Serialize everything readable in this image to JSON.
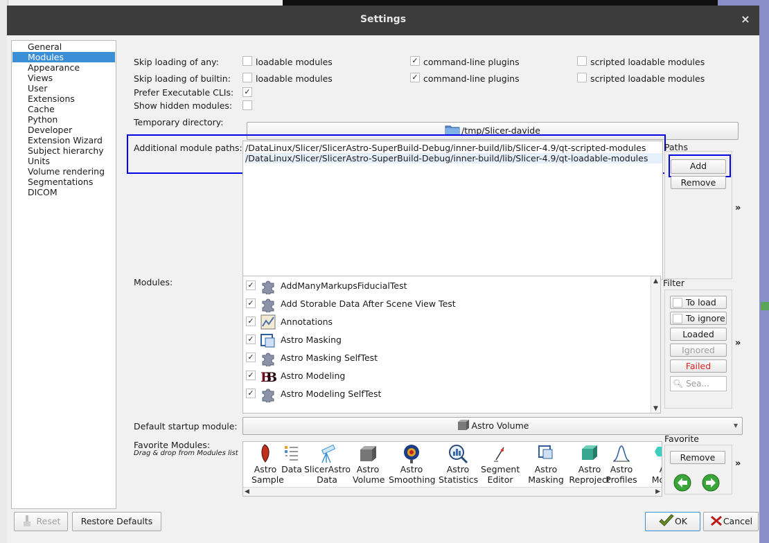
{
  "dialog": {
    "title": "Settings",
    "close_glyph": "×"
  },
  "nav": {
    "items": [
      "General",
      "Modules",
      "Appearance",
      "Views",
      "User",
      "Extensions",
      "Cache",
      "Python",
      "Developer",
      "Extension Wizard",
      "Subject hierarchy",
      "Units",
      "Volume rendering",
      "Segmentations",
      "DICOM"
    ],
    "selected": "Modules"
  },
  "skip_any": {
    "label": "Skip loading of any:",
    "loadable": {
      "label": "loadable modules",
      "checked": false
    },
    "cli": {
      "label": "command-line plugins",
      "checked": true
    },
    "scripted": {
      "label": "scripted loadable modules",
      "checked": false
    }
  },
  "skip_builtin": {
    "label": "Skip loading of builtin:",
    "loadable": {
      "label": "loadable modules",
      "checked": false
    },
    "cli": {
      "label": "command-line plugins",
      "checked": true
    },
    "scripted": {
      "label": "scripted loadable modules",
      "checked": false
    }
  },
  "prefer_cli": {
    "label": "Prefer Executable CLIs:",
    "checked": true
  },
  "show_hidden": {
    "label": "Show hidden modules:",
    "checked": false
  },
  "check_glyph": "✓",
  "temp_dir": {
    "label": "Temporary directory:",
    "value": "/tmp/Slicer-davide",
    "icon": "folder-icon"
  },
  "module_paths": {
    "label": "Additional module paths:",
    "paths": [
      "/DataLinux/Slicer/SlicerAstro-SuperBuild-Debug/inner-build/lib/Slicer-4.9/qt-scripted-modules",
      "/DataLinux/Slicer/SlicerAstro-SuperBuild-Debug/inner-build/lib/Slicer-4.9/qt-loadable-modules"
    ],
    "side_title": "Paths",
    "add_label": "Add",
    "remove_label": "Remove",
    "expand_glyph": "»"
  },
  "modules": {
    "label": "Modules:",
    "items": [
      {
        "name": "AddManyMarkupsFiducialTest",
        "checked": true,
        "icon": "puzzle-icon"
      },
      {
        "name": "Add Storable Data After Scene View Test",
        "checked": true,
        "icon": "puzzle-icon"
      },
      {
        "name": "Annotations",
        "checked": true,
        "icon": "annotations-icon"
      },
      {
        "name": "Astro Masking",
        "checked": true,
        "icon": "astro-masking-icon"
      },
      {
        "name": "Astro Masking SelfTest",
        "checked": true,
        "icon": "puzzle-icon"
      },
      {
        "name": "Astro Modeling",
        "checked": true,
        "icon": "astro-modeling-icon"
      },
      {
        "name": "Astro Modeling SelfTest",
        "checked": true,
        "icon": "puzzle-icon"
      }
    ],
    "filter_title": "Filter",
    "filters": [
      {
        "label": "To load",
        "checkbox": true
      },
      {
        "label": "To ignore",
        "checkbox": true
      },
      {
        "label": "Loaded",
        "checkbox": false
      },
      {
        "label": "Ignored",
        "checkbox": false
      },
      {
        "label": "Failed",
        "checkbox": false
      }
    ],
    "search_placeholder": "Sea...",
    "expand_glyph": "»"
  },
  "startup": {
    "label": "Default startup module:",
    "value": "Astro Volume",
    "icon": "astro-volume-icon"
  },
  "favorites": {
    "label": "Favorite Modules:",
    "hint": "Drag & drop from Modules list",
    "items": [
      {
        "lines": [
          "Astro",
          "Sample"
        ],
        "icon": "astro-sample-icon"
      },
      {
        "lines": [
          "Data"
        ],
        "icon": "data-icon"
      },
      {
        "lines": [
          "SlicerAstro",
          "Data"
        ],
        "icon": "telescope-icon"
      },
      {
        "lines": [
          "Astro",
          "Volume"
        ],
        "icon": "astro-volume-icon"
      },
      {
        "lines": [
          "Astro",
          "Smoothing"
        ],
        "icon": "astro-smoothing-icon"
      },
      {
        "lines": [
          "Astro",
          "Statistics"
        ],
        "icon": "astro-statistics-icon"
      },
      {
        "lines": [
          "Segment",
          "Editor"
        ],
        "icon": "segment-editor-icon"
      },
      {
        "lines": [
          "Astro",
          "Masking"
        ],
        "icon": "astro-masking-icon"
      },
      {
        "lines": [
          "Astro",
          "Reproject"
        ],
        "icon": "astro-reproject-icon"
      },
      {
        "lines": [
          "Astro",
          "Profiles"
        ],
        "icon": "astro-profiles-icon"
      },
      {
        "lines": [
          "A",
          "Mom"
        ],
        "icon": "astro-moments-icon"
      }
    ],
    "side_title": "Favorite",
    "remove_label": "Remove",
    "expand_glyph": "»"
  },
  "footer": {
    "reset_label": "Reset",
    "restore_label": "Restore Defaults",
    "ok_label": "OK",
    "cancel_label": "Cancel"
  },
  "colors": {
    "title_bg": "#3c3c3c",
    "selection": "#3a8fd6",
    "highlight": "#0000e6",
    "failed": "#e02020",
    "check_green": "#3aa63a"
  }
}
